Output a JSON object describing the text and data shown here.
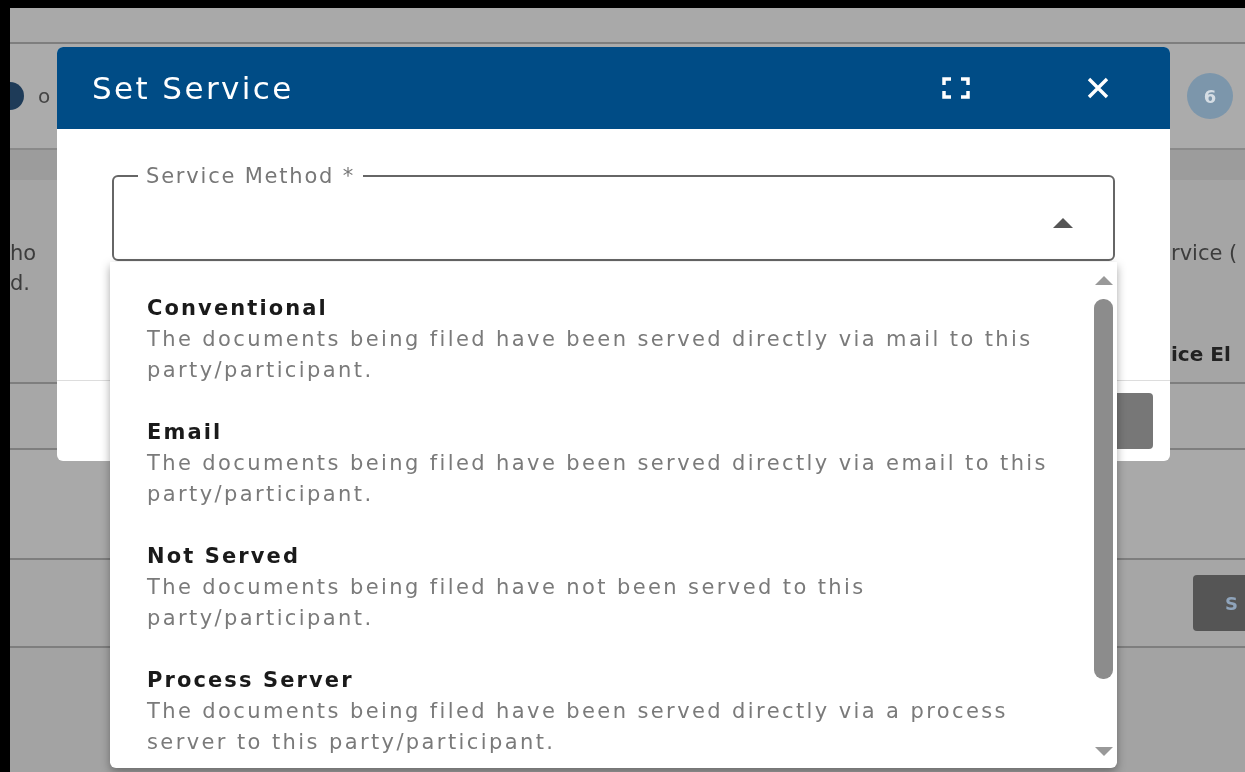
{
  "background": {
    "step_label": "o",
    "step_badge": "6",
    "left_text": [
      "ho",
      "d."
    ],
    "right_text": "rvice (",
    "right_heading": "ice El",
    "side_button": "S"
  },
  "dialog": {
    "title": "Set Service",
    "field": {
      "label": "Service Method *",
      "expanded": true
    },
    "options": [
      {
        "title": "Conventional",
        "description": "The documents being filed have been served directly via mail to this party/participant.",
        "selected": false
      },
      {
        "title": "Email",
        "description": "The documents being filed have been served directly via email to this party/participant.",
        "selected": false
      },
      {
        "title": "Not Served",
        "description": "The documents being filed have not been served to this party/participant.",
        "selected": false
      },
      {
        "title": "Process Server",
        "description": "The documents being filed have been served directly via a process server to this party/participant.",
        "selected": false
      }
    ]
  }
}
